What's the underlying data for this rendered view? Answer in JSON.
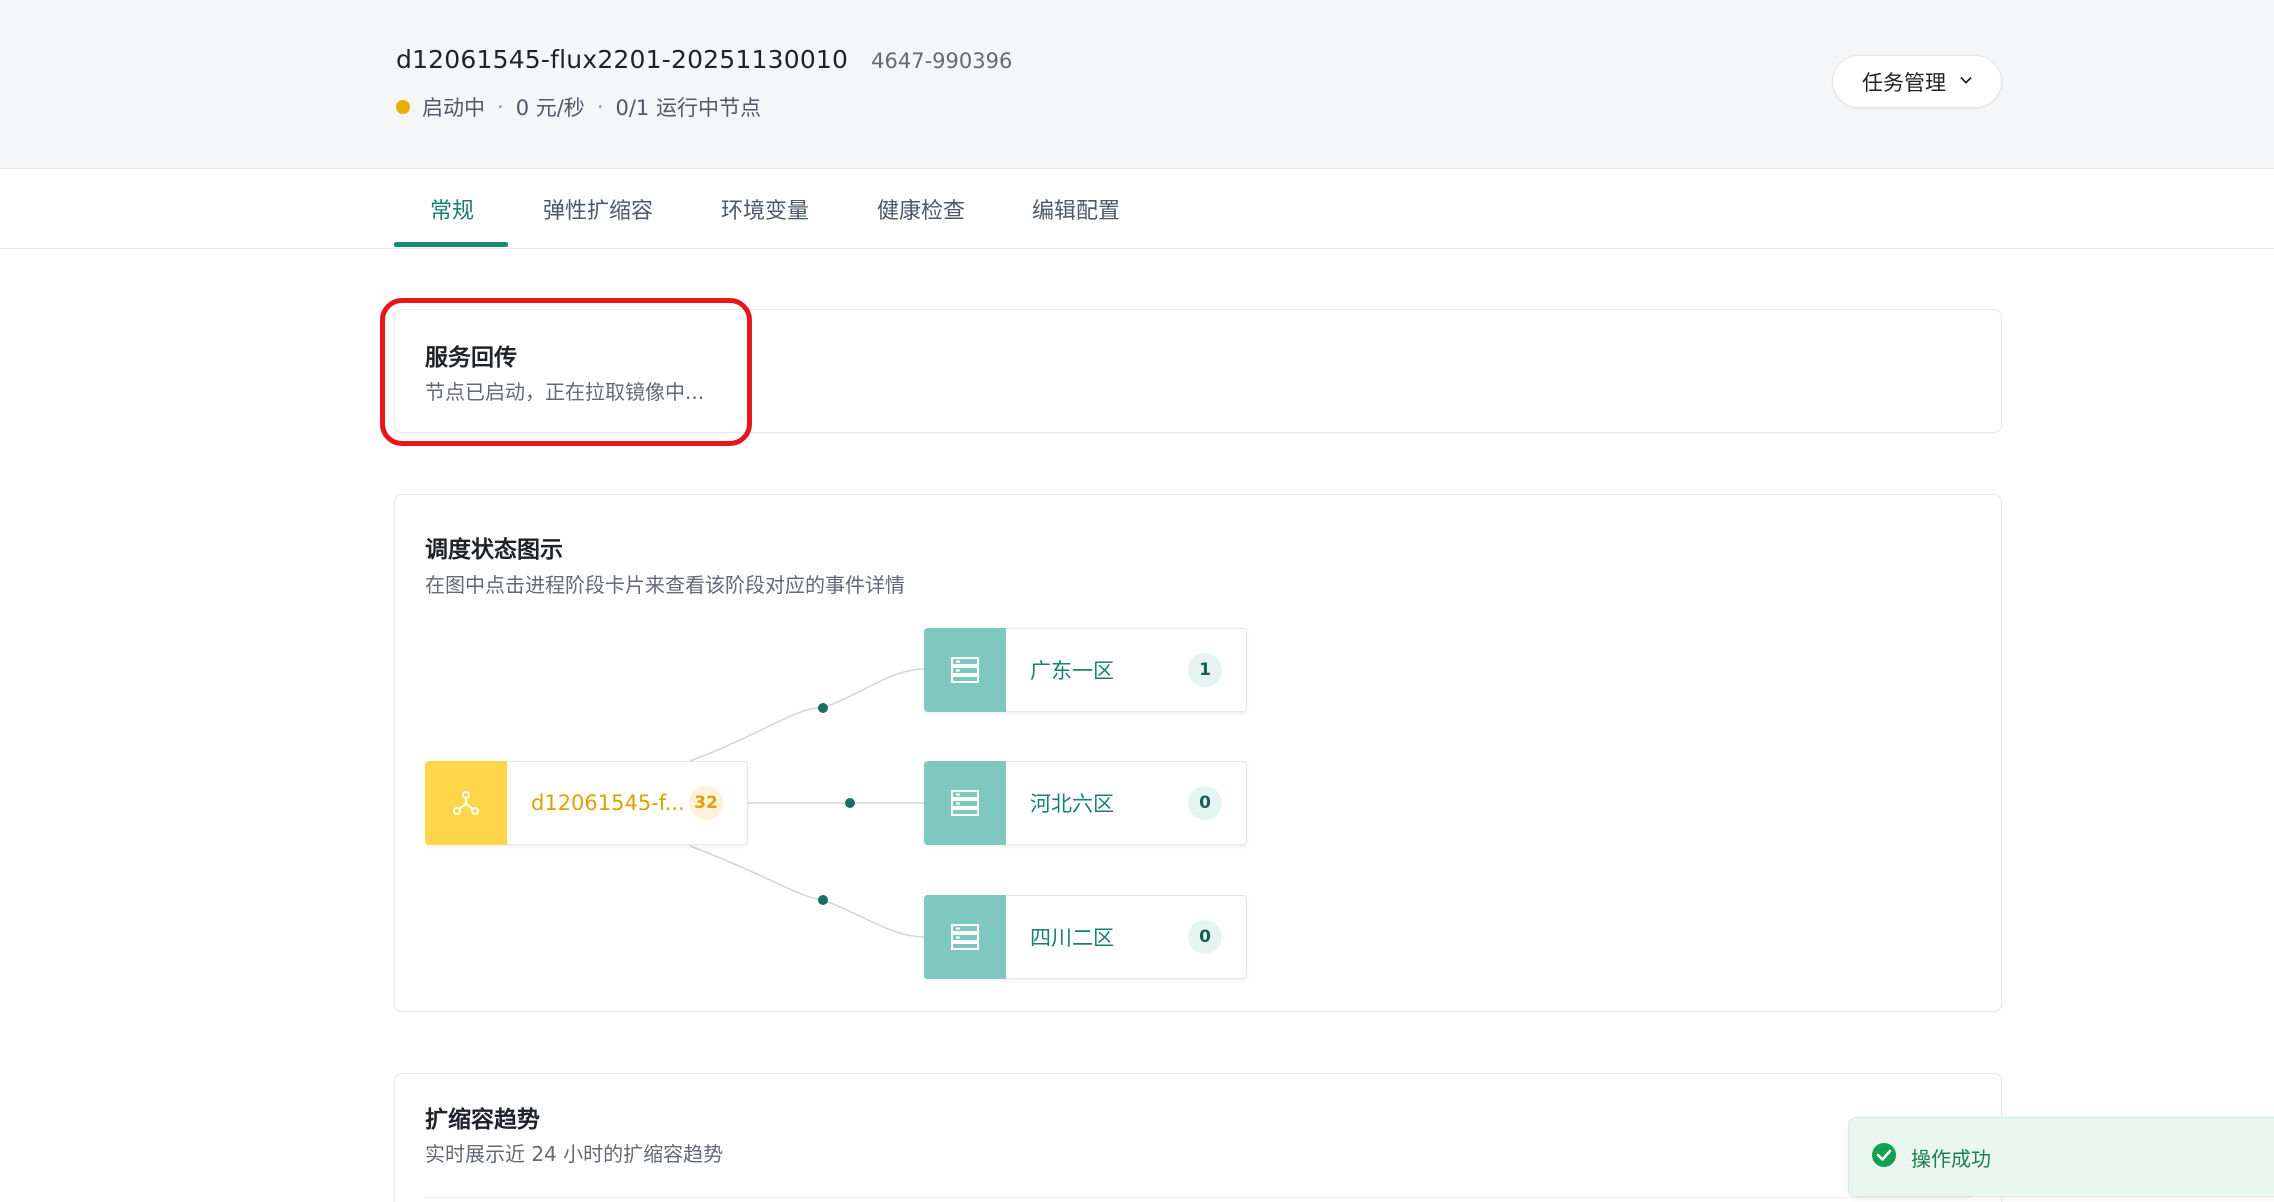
{
  "header": {
    "task_name": "d12061545-flux2201-20251130010",
    "task_id": "4647-990396",
    "status": "启动中",
    "price": "0 元/秒",
    "nodes": "0/1 运行中节点",
    "separator": "·",
    "task_menu_label": "任务管理",
    "status_color": "#e6b000"
  },
  "tabs": [
    {
      "label": "常规",
      "active": true
    },
    {
      "label": "弹性扩缩容",
      "active": false
    },
    {
      "label": "环境变量",
      "active": false
    },
    {
      "label": "健康检查",
      "active": false
    },
    {
      "label": "编辑配置",
      "active": false
    }
  ],
  "service_callback": {
    "title": "服务回传",
    "message": "节点已启动，正在拉取镜像中..."
  },
  "schedule": {
    "title": "调度状态图示",
    "description": "在图中点击进程阶段卡片来查看该阶段对应的事件详情",
    "source": {
      "label": "d12061545-f...",
      "count": "32",
      "icon": "network-icon"
    },
    "regions": [
      {
        "label": "广东一区",
        "count": "1",
        "icon": "server-icon"
      },
      {
        "label": "河北六区",
        "count": "0",
        "icon": "server-icon"
      },
      {
        "label": "四川二区",
        "count": "0",
        "icon": "server-icon"
      }
    ]
  },
  "scaling_trend": {
    "title": "扩缩容趋势",
    "description": "实时展示近 24 小时的扩缩容趋势"
  },
  "toast": {
    "message": "操作成功",
    "icon": "check-circle-icon"
  },
  "colors": {
    "accent": "#1a8a78",
    "highlight": "#e8161b",
    "source_node": "#ffd54a",
    "region_node": "#7fc8bf"
  }
}
